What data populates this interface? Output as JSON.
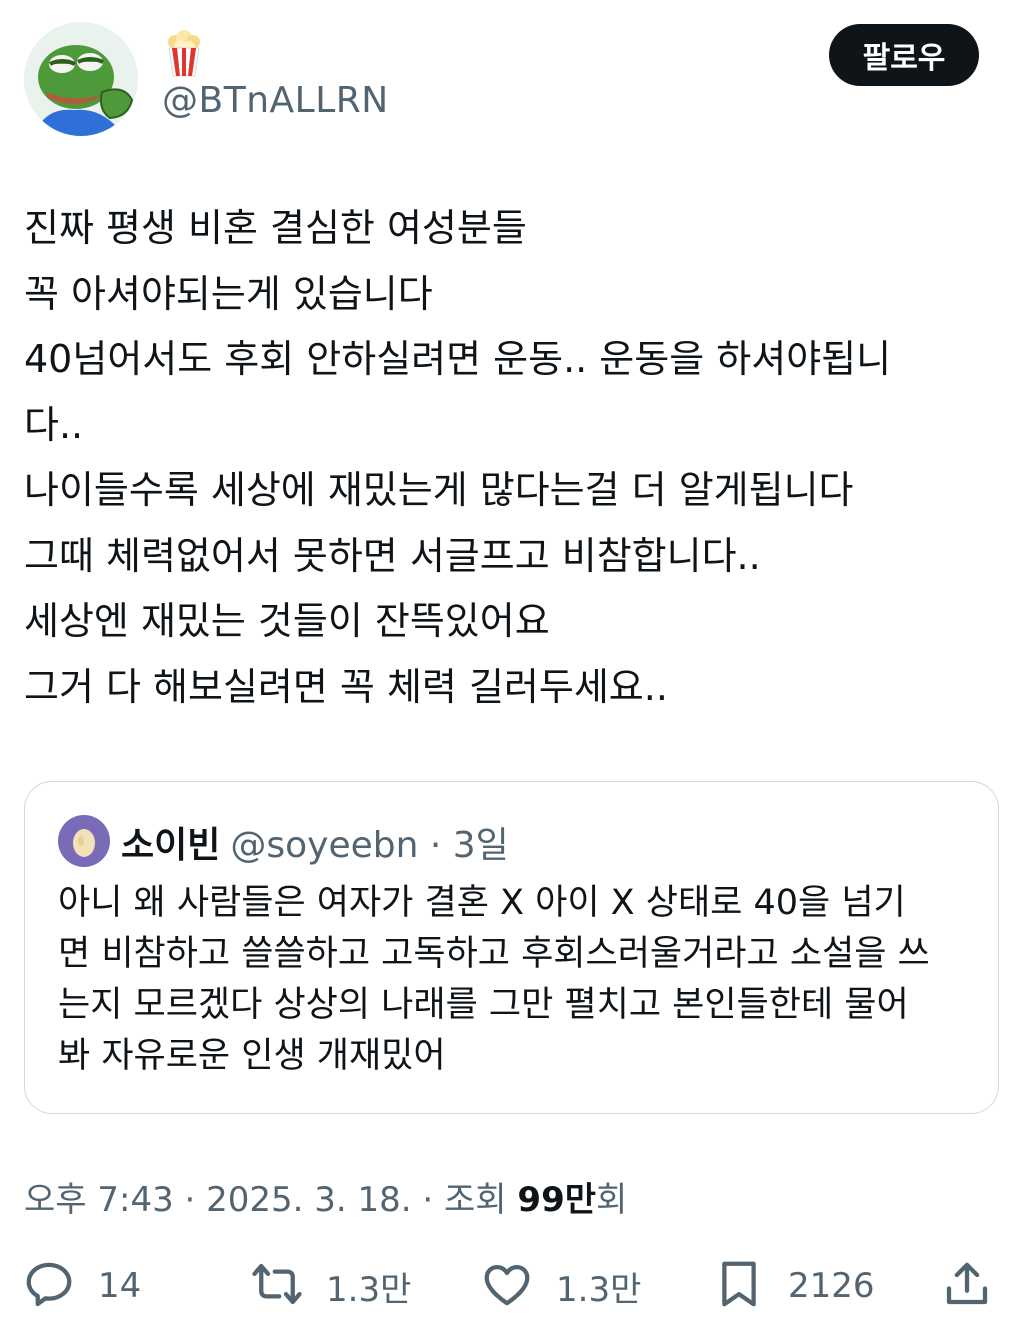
{
  "author": {
    "emoji_icon": "popcorn-icon",
    "handle": "@BTnALLRN"
  },
  "follow_button": "팔로우",
  "tweet_lines": [
    "진짜 평생 비혼 결심한 여성분들",
    "꼭 아셔야되는게 있습니다",
    "40넘어서도 후회 안하실려면 운동.. 운동을 하셔야됩니",
    "다..",
    "나이들수록 세상에 재밌는게 많다는걸 더 알게됩니다",
    "그때 체력없어서 못하면 서글프고 비참합니다..",
    "세상엔 재밌는 것들이 잔뜩있어요",
    "그거 다 해보실려면 꼭 체력 길러두세요.."
  ],
  "quoted": {
    "name": "소이빈",
    "handle_time": "@soyeebn · 3일",
    "lines": [
      "아니 왜 사람들은 여자가 결혼 X 아이 X 상태로 40을 넘기",
      "면 비참하고 쓸쓸하고 고독하고 후회스러울거라고 소설을 쓰",
      "는지 모르겠다 상상의 나래를 그만 펼치고 본인들한테 물어",
      "봐 자유로운 인생 개재밌어"
    ]
  },
  "meta": {
    "datetime": "오후 7:43 · 2025. 3. 18. · 조회 ",
    "views": "99만",
    "views_suffix": "회"
  },
  "actions": {
    "replies": "14",
    "retweets": "1.3만",
    "likes": "1.3만",
    "bookmarks": "2126"
  },
  "colors": {
    "text": "#0f1419",
    "secondary": "#536471",
    "border": "#cfd9de",
    "follow_bg": "#0f1419"
  }
}
